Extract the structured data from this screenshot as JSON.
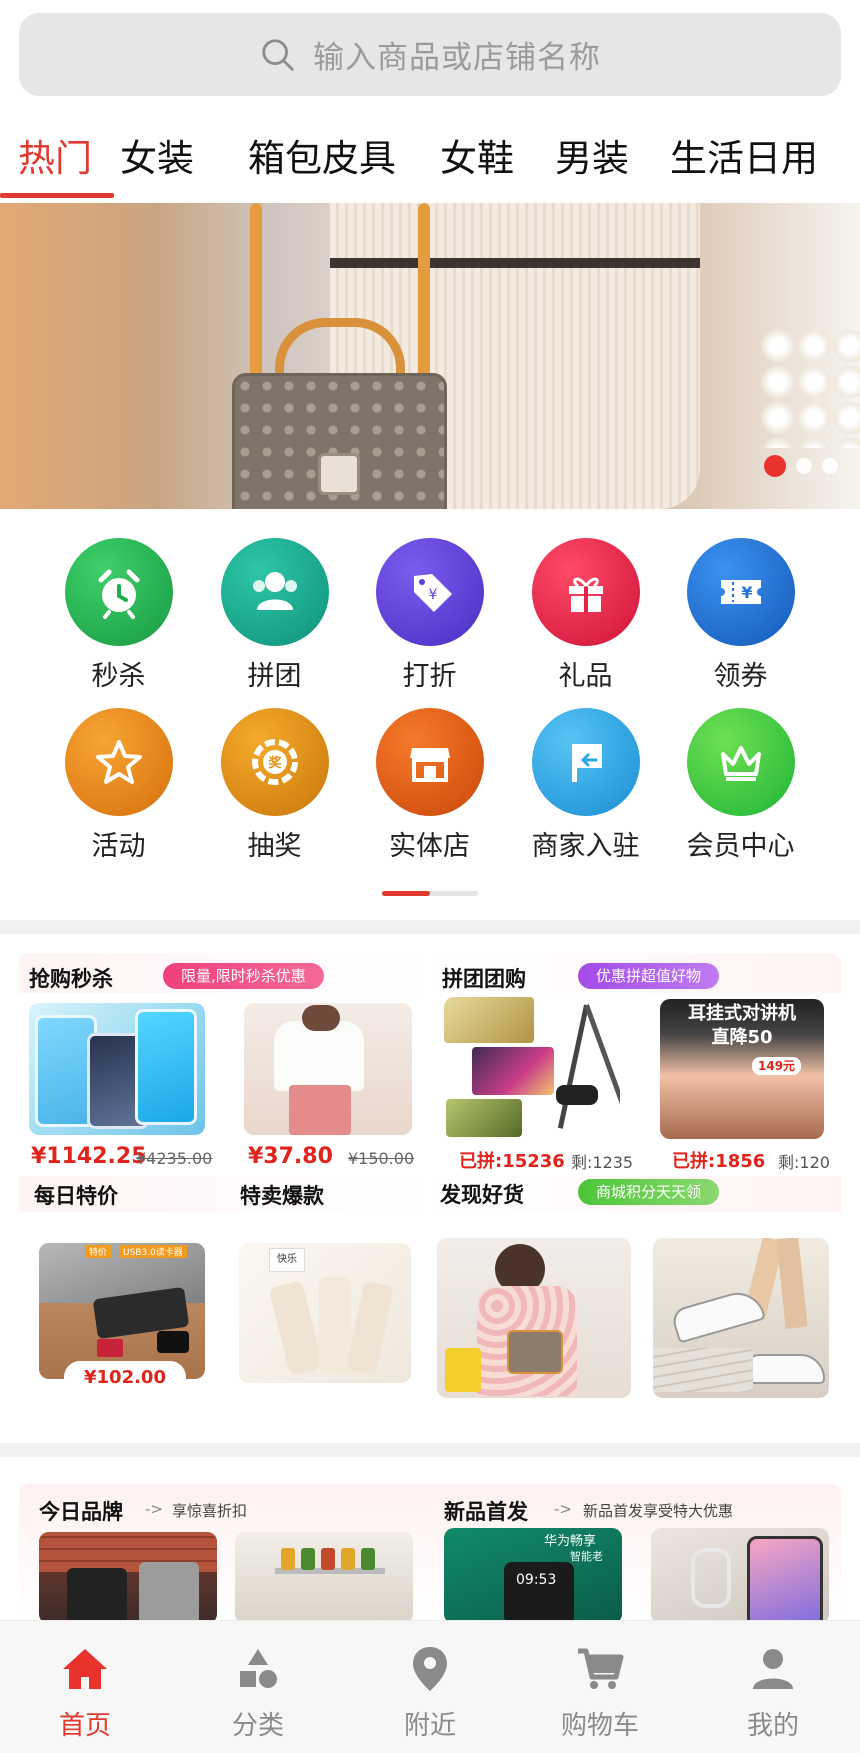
{
  "search": {
    "placeholder": "输入商品或店铺名称"
  },
  "tabs": [
    {
      "label": "热门",
      "active": true
    },
    {
      "label": "女装"
    },
    {
      "label": "箱包皮具"
    },
    {
      "label": "女鞋"
    },
    {
      "label": "男装"
    },
    {
      "label": "生活日用"
    }
  ],
  "banner": {
    "slides": 3,
    "active_slide": 1
  },
  "features": [
    {
      "label": "秒杀",
      "icon": "alarm-clock-icon",
      "color": "#1fae4e"
    },
    {
      "label": "拼团",
      "icon": "group-users-icon",
      "color": "#12a68b"
    },
    {
      "label": "打折",
      "icon": "price-tag-icon",
      "color": "#5b3fd8"
    },
    {
      "label": "礼品",
      "icon": "gift-icon",
      "color": "#e5234b"
    },
    {
      "label": "领券",
      "icon": "coupon-icon",
      "color": "#1f73d9"
    },
    {
      "label": "活动",
      "icon": "star-icon",
      "color": "#f08b1d"
    },
    {
      "label": "抽奖",
      "icon": "lottery-wheel-icon",
      "color": "#e08d14"
    },
    {
      "label": "实体店",
      "icon": "storefront-icon",
      "color": "#e35a12"
    },
    {
      "label": "商家入驻",
      "icon": "flag-icon",
      "color": "#2aa8e8"
    },
    {
      "label": "会员中心",
      "icon": "crown-icon",
      "color": "#3fcb3a"
    }
  ],
  "flash_sale": {
    "title": "抢购秒杀",
    "badge": "限量,限时秒杀优惠",
    "items": [
      {
        "price": "¥1142.25",
        "original": "¥4235.00"
      },
      {
        "price": "¥37.80",
        "original": "¥150.00"
      }
    ]
  },
  "group_buy": {
    "title": "拼团团购",
    "badge": "优惠拼超值好物",
    "items": [
      {
        "joined": "已拼:15236",
        "remaining": "剩:1235"
      },
      {
        "joined": "已拼:1856",
        "remaining": "剩:120",
        "overlay_line1": "耳挂式对讲机",
        "overlay_line2": "直降50",
        "overlay_price": "149元"
      }
    ]
  },
  "daily_deal": {
    "title": "每日特价",
    "price": "¥102.00",
    "tag_small_1": "特价",
    "tag_small_2": "USB3.0读卡器"
  },
  "hot_sale": {
    "title": "特卖爆款",
    "tag_small": "快乐"
  },
  "discover": {
    "title": "发现好货",
    "badge": "商城积分天天领"
  },
  "brand_today": {
    "title": "今日品牌",
    "arrow": "->",
    "subtitle": "享惊喜折扣"
  },
  "new_launch": {
    "title": "新品首发",
    "arrow": "->",
    "subtitle": "新品首发享受特大优惠",
    "phone_brand": "华为畅享",
    "phone_sub": "智能老",
    "phone_time": "09:53"
  },
  "bottom_nav": [
    {
      "label": "首页",
      "icon": "home-icon",
      "active": true
    },
    {
      "label": "分类",
      "icon": "category-shapes-icon"
    },
    {
      "label": "附近",
      "icon": "location-pin-icon"
    },
    {
      "label": "购物车",
      "icon": "shopping-cart-icon"
    },
    {
      "label": "我的",
      "icon": "user-profile-icon"
    }
  ],
  "colors": {
    "accent": "#e03a2f",
    "price": "#e0241b"
  }
}
